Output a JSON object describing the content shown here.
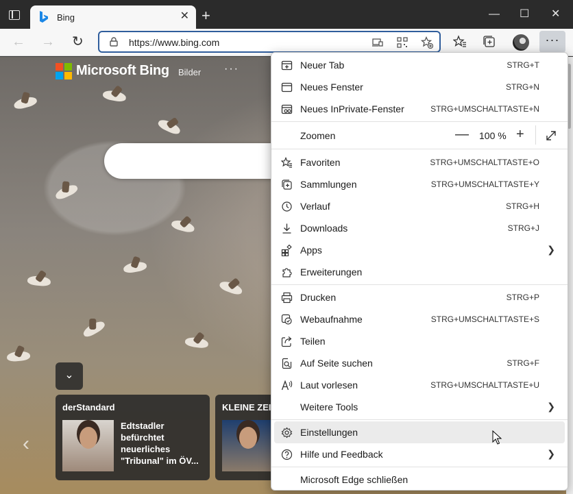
{
  "browser": {
    "tab_title": "Bing",
    "url": "https://www.bing.com",
    "tab_close": "✕",
    "new_tab": "+",
    "more_label": "···"
  },
  "page": {
    "brand_name": "Microsoft Bing",
    "nav_bilder": "Bilder",
    "nav_more": "···",
    "news": [
      {
        "source": "derStandard",
        "headline": "Edtstadler befürchtet neuerliches \"Tribunal\" im ÖV..."
      },
      {
        "source": "KLEINE ZEITU",
        "headline": ""
      }
    ]
  },
  "menu": {
    "items": [
      {
        "label": "Neuer Tab",
        "shortcut": "STRG+T",
        "icon": "new-tab-icon"
      },
      {
        "label": "Neues Fenster",
        "shortcut": "STRG+N",
        "icon": "new-window-icon"
      },
      {
        "label": "Neues InPrivate-Fenster",
        "shortcut": "STRG+UMSCHALTTASTE+N",
        "icon": "inprivate-icon"
      },
      {
        "label": "Favoriten",
        "shortcut": "STRG+UMSCHALTTASTE+O",
        "icon": "favorites-icon"
      },
      {
        "label": "Sammlungen",
        "shortcut": "STRG+UMSCHALTTASTE+Y",
        "icon": "collections-icon"
      },
      {
        "label": "Verlauf",
        "shortcut": "STRG+H",
        "icon": "history-icon"
      },
      {
        "label": "Downloads",
        "shortcut": "STRG+J",
        "icon": "download-icon"
      },
      {
        "label": "Apps",
        "shortcut": "",
        "icon": "apps-icon"
      },
      {
        "label": "Erweiterungen",
        "shortcut": "",
        "icon": "extensions-icon"
      },
      {
        "label": "Drucken",
        "shortcut": "STRG+P",
        "icon": "print-icon"
      },
      {
        "label": "Webaufnahme",
        "shortcut": "STRG+UMSCHALTTASTE+S",
        "icon": "web-capture-icon"
      },
      {
        "label": "Teilen",
        "shortcut": "",
        "icon": "share-icon"
      },
      {
        "label": "Auf Seite suchen",
        "shortcut": "STRG+F",
        "icon": "find-icon"
      },
      {
        "label": "Laut vorlesen",
        "shortcut": "STRG+UMSCHALTTASTE+U",
        "icon": "read-aloud-icon"
      },
      {
        "label": "Weitere Tools",
        "shortcut": "",
        "icon": ""
      },
      {
        "label": "Einstellungen",
        "shortcut": "",
        "icon": "settings-icon"
      },
      {
        "label": "Hilfe und Feedback",
        "shortcut": "",
        "icon": "help-icon"
      },
      {
        "label": "Microsoft Edge schließen",
        "shortcut": "",
        "icon": ""
      }
    ],
    "zoom": {
      "label": "Zoomen",
      "value": "100 %",
      "minus": "—",
      "plus": "+"
    }
  }
}
